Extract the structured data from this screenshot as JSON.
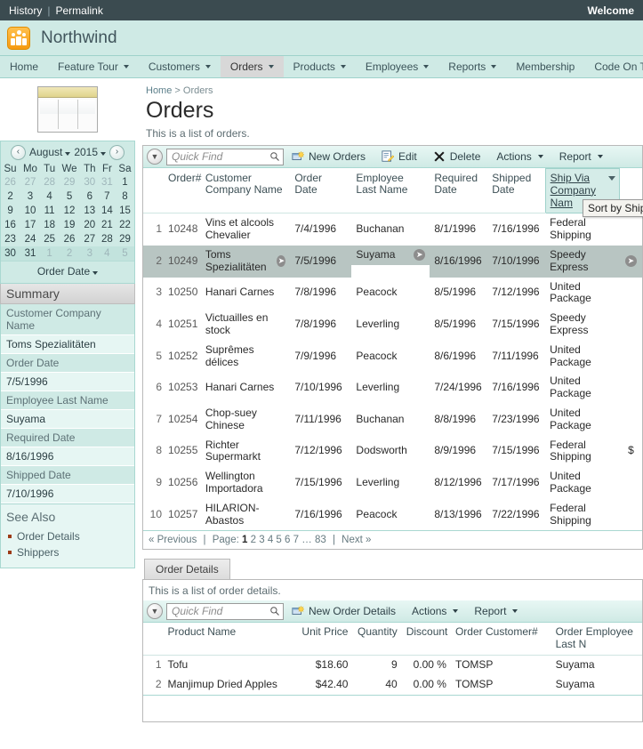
{
  "topbar": {
    "history": "History",
    "permalink": "Permalink",
    "welcome": "Welcome"
  },
  "brand": {
    "name": "Northwind"
  },
  "nav": [
    {
      "label": "Home",
      "caret": false,
      "active": false
    },
    {
      "label": "Feature Tour",
      "caret": true,
      "active": false
    },
    {
      "label": "Customers",
      "caret": true,
      "active": false
    },
    {
      "label": "Orders",
      "caret": true,
      "active": true
    },
    {
      "label": "Products",
      "caret": true,
      "active": false
    },
    {
      "label": "Employees",
      "caret": true,
      "active": false
    },
    {
      "label": "Reports",
      "caret": true,
      "active": false
    },
    {
      "label": "Membership",
      "caret": false,
      "active": false
    },
    {
      "label": "Code On Time",
      "caret": false,
      "active": false
    }
  ],
  "calendar": {
    "month": "August",
    "year": "2015",
    "prev": "‹",
    "next": "›",
    "daynames": [
      "Su",
      "Mo",
      "Tu",
      "We",
      "Th",
      "Fr",
      "Sa"
    ],
    "weeks": [
      [
        {
          "d": "26",
          "out": true
        },
        {
          "d": "27",
          "out": true
        },
        {
          "d": "28",
          "out": true
        },
        {
          "d": "29",
          "out": true
        },
        {
          "d": "30",
          "out": true
        },
        {
          "d": "31",
          "out": true
        },
        {
          "d": "1",
          "out": false
        }
      ],
      [
        {
          "d": "2",
          "out": false
        },
        {
          "d": "3",
          "out": false
        },
        {
          "d": "4",
          "out": false
        },
        {
          "d": "5",
          "out": false
        },
        {
          "d": "6",
          "out": false
        },
        {
          "d": "7",
          "out": false
        },
        {
          "d": "8",
          "out": false
        }
      ],
      [
        {
          "d": "9",
          "out": false
        },
        {
          "d": "10",
          "out": false
        },
        {
          "d": "11",
          "out": false
        },
        {
          "d": "12",
          "out": false
        },
        {
          "d": "13",
          "out": false
        },
        {
          "d": "14",
          "out": false
        },
        {
          "d": "15",
          "out": false
        }
      ],
      [
        {
          "d": "16",
          "out": false
        },
        {
          "d": "17",
          "out": false
        },
        {
          "d": "18",
          "out": false
        },
        {
          "d": "19",
          "out": false
        },
        {
          "d": "20",
          "out": false
        },
        {
          "d": "21",
          "out": false
        },
        {
          "d": "22",
          "out": false
        }
      ],
      [
        {
          "d": "23",
          "out": false
        },
        {
          "d": "24",
          "out": false
        },
        {
          "d": "25",
          "out": false
        },
        {
          "d": "26",
          "out": false
        },
        {
          "d": "27",
          "out": false
        },
        {
          "d": "28",
          "out": false
        },
        {
          "d": "29",
          "out": false
        }
      ],
      [
        {
          "d": "30",
          "out": false
        },
        {
          "d": "31",
          "out": false
        },
        {
          "d": "1",
          "out": true
        },
        {
          "d": "2",
          "out": true
        },
        {
          "d": "3",
          "out": true
        },
        {
          "d": "4",
          "out": true
        },
        {
          "d": "5",
          "out": true
        }
      ]
    ],
    "footer": "Order Date"
  },
  "summary": {
    "heading": "Summary",
    "fields": [
      {
        "label": "Customer Company Name",
        "value": "Toms Spezialitäten"
      },
      {
        "label": "Order Date",
        "value": "7/5/1996"
      },
      {
        "label": "Employee Last Name",
        "value": "Suyama"
      },
      {
        "label": "Required Date",
        "value": "8/16/1996"
      },
      {
        "label": "Shipped Date",
        "value": "7/10/1996"
      }
    ]
  },
  "see_also": {
    "heading": "See Also",
    "links": [
      "Order Details",
      "Shippers"
    ]
  },
  "main": {
    "breadcrumb_home": "Home",
    "breadcrumb_sep": ">",
    "breadcrumb_current": "Orders",
    "title": "Orders",
    "subtitle": "This is a list of orders.",
    "toolbar": {
      "quickfind_placeholder": "Quick Find",
      "quickfind_value": "",
      "new": "New Orders",
      "edit": "Edit",
      "delete": "Delete",
      "actions": "Actions",
      "report": "Report"
    },
    "columns": [
      "Order#",
      "Customer Company Name",
      "Order Date",
      "Employee Last Name",
      "Required Date",
      "Shipped Date",
      "Ship Via Company Nam"
    ],
    "sorted_column": "Ship Via Company Nam",
    "tooltip": "Sort by Ship",
    "rows": [
      {
        "n": "1",
        "order": "10248",
        "customer": "Vins et alcools Chevalier",
        "order_date": "7/4/1996",
        "employee": "Buchanan",
        "required": "8/1/1996",
        "shipped": "7/16/1996",
        "shipvia": "Federal Shipping",
        "selected": false,
        "extra": ""
      },
      {
        "n": "2",
        "order": "10249",
        "customer": "Toms Spezialitäten",
        "order_date": "7/5/1996",
        "employee": "Suyama",
        "required": "8/16/1996",
        "shipped": "7/10/1996",
        "shipvia": "Speedy Express",
        "selected": true,
        "extra": ""
      },
      {
        "n": "3",
        "order": "10250",
        "customer": "Hanari Carnes",
        "order_date": "7/8/1996",
        "employee": "Peacock",
        "required": "8/5/1996",
        "shipped": "7/12/1996",
        "shipvia": "United Package",
        "selected": false,
        "extra": ""
      },
      {
        "n": "4",
        "order": "10251",
        "customer": "Victuailles en stock",
        "order_date": "7/8/1996",
        "employee": "Leverling",
        "required": "8/5/1996",
        "shipped": "7/15/1996",
        "shipvia": "Speedy Express",
        "selected": false,
        "extra": ""
      },
      {
        "n": "5",
        "order": "10252",
        "customer": "Suprêmes délices",
        "order_date": "7/9/1996",
        "employee": "Peacock",
        "required": "8/6/1996",
        "shipped": "7/11/1996",
        "shipvia": "United Package",
        "selected": false,
        "extra": ""
      },
      {
        "n": "6",
        "order": "10253",
        "customer": "Hanari Carnes",
        "order_date": "7/10/1996",
        "employee": "Leverling",
        "required": "7/24/1996",
        "shipped": "7/16/1996",
        "shipvia": "United Package",
        "selected": false,
        "extra": ""
      },
      {
        "n": "7",
        "order": "10254",
        "customer": "Chop-suey Chinese",
        "order_date": "7/11/1996",
        "employee": "Buchanan",
        "required": "8/8/1996",
        "shipped": "7/23/1996",
        "shipvia": "United Package",
        "selected": false,
        "extra": ""
      },
      {
        "n": "8",
        "order": "10255",
        "customer": "Richter Supermarkt",
        "order_date": "7/12/1996",
        "employee": "Dodsworth",
        "required": "8/9/1996",
        "shipped": "7/15/1996",
        "shipvia": "Federal Shipping",
        "selected": false,
        "extra": "$"
      },
      {
        "n": "9",
        "order": "10256",
        "customer": "Wellington Importadora",
        "order_date": "7/15/1996",
        "employee": "Leverling",
        "required": "8/12/1996",
        "shipped": "7/17/1996",
        "shipvia": "United Package",
        "selected": false,
        "extra": ""
      },
      {
        "n": "10",
        "order": "10257",
        "customer": "HILARION-Abastos",
        "order_date": "7/16/1996",
        "employee": "Peacock",
        "required": "8/13/1996",
        "shipped": "7/22/1996",
        "shipvia": "Federal Shipping",
        "selected": false,
        "extra": ""
      }
    ],
    "pager": {
      "previous": "« Previous",
      "page_label": "Page:",
      "pages": [
        "1",
        "2",
        "3",
        "4",
        "5",
        "6",
        "7",
        "…",
        "83"
      ],
      "current_page": "1",
      "next": "Next »"
    }
  },
  "details": {
    "tab": "Order Details",
    "subtitle": "This is a list of order details.",
    "toolbar": {
      "quickfind_placeholder": "Quick Find",
      "quickfind_value": "",
      "new": "New Order Details",
      "actions": "Actions",
      "report": "Report"
    },
    "columns": [
      "Product Name",
      "Unit Price",
      "Quantity",
      "Discount",
      "Order Customer#",
      "Order Employee Last N"
    ],
    "rows": [
      {
        "n": "1",
        "product": "Tofu",
        "price": "$18.60",
        "qty": "9",
        "discount": "0.00 %",
        "cust": "TOMSP",
        "employee": "Suyama"
      },
      {
        "n": "2",
        "product": "Manjimup Dried Apples",
        "price": "$42.40",
        "qty": "40",
        "discount": "0.00 %",
        "cust": "TOMSP",
        "employee": "Suyama"
      }
    ]
  },
  "colors": {
    "topbar": "#3b4b50",
    "brand_band": "#cfeae5",
    "accent": "#9fd2cb",
    "selected_row": "#b8c5c2",
    "logo_orange": "#f59a11"
  }
}
